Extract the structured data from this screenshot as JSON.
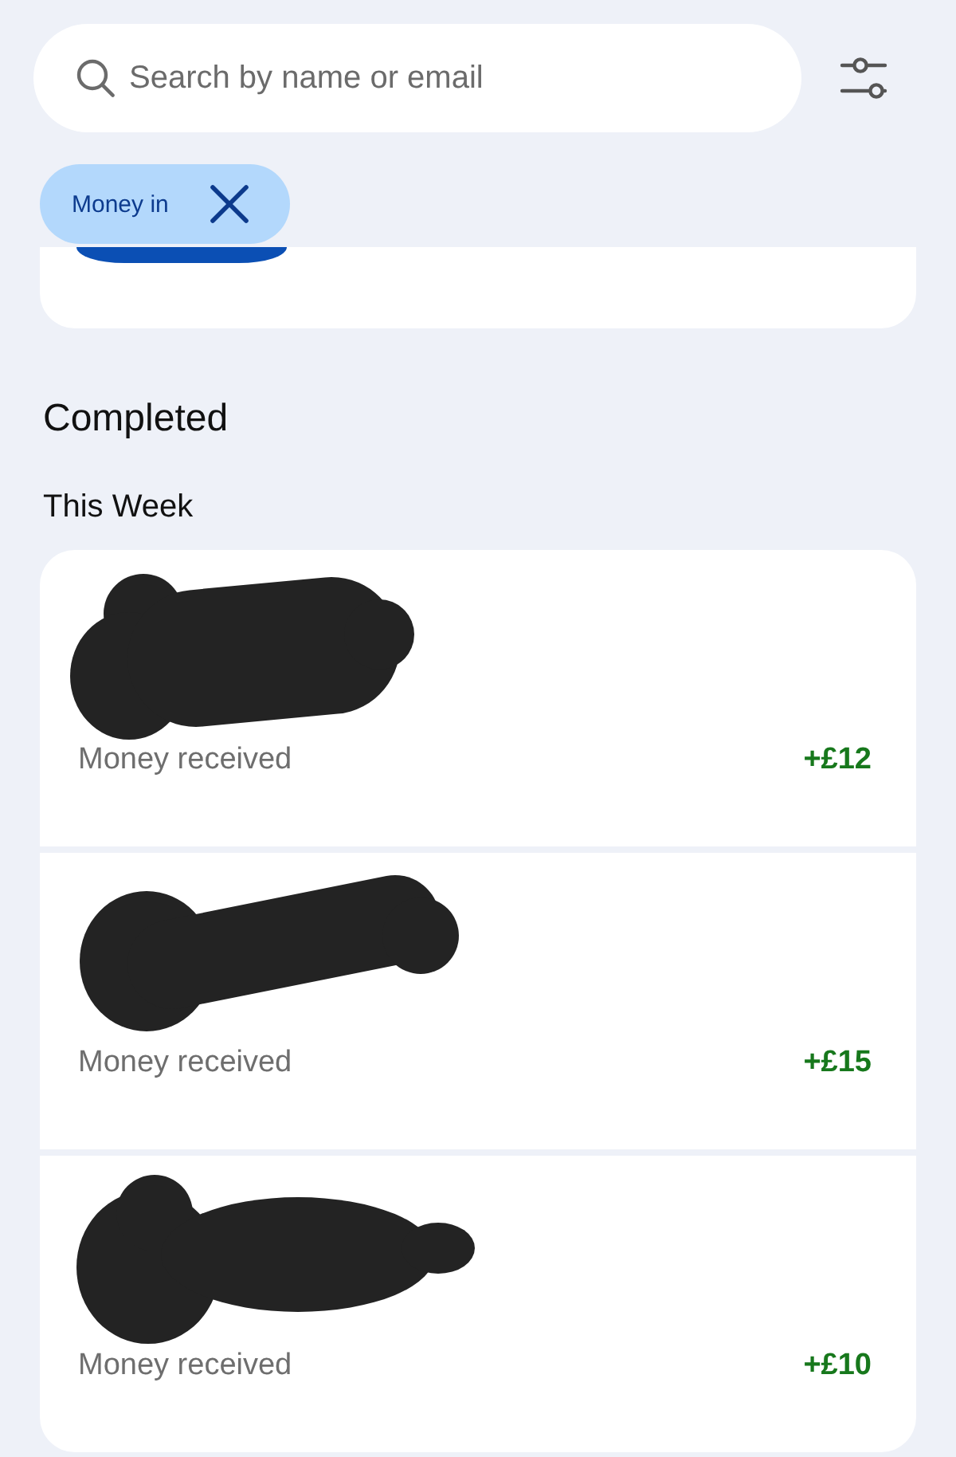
{
  "search": {
    "placeholder": "Search by name or email"
  },
  "filter_chips": [
    {
      "label": "Money in"
    }
  ],
  "completed": {
    "title": "Completed",
    "groups": [
      {
        "title": "This Week",
        "transactions": [
          {
            "redacted": true,
            "description": "Money received",
            "amount": "+£12"
          },
          {
            "redacted": true,
            "description": "Money received",
            "amount": "+£15"
          },
          {
            "redacted": true,
            "description": "Money received",
            "amount": "+£10"
          }
        ]
      }
    ]
  }
}
